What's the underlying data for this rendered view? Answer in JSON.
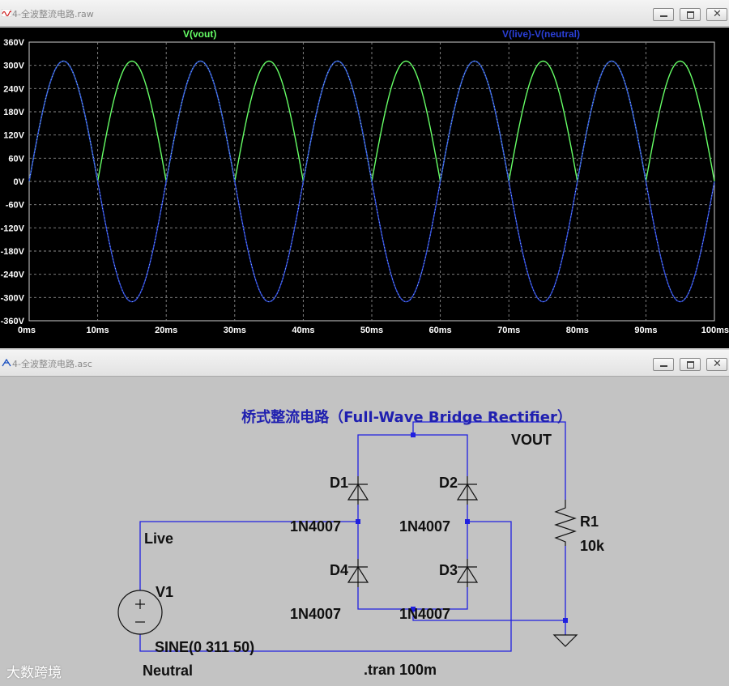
{
  "plot_window": {
    "title": "4-全波整流电路.raw",
    "icon": "waveform-icon"
  },
  "schematic_window": {
    "title": "4-全波整流电路.asc",
    "icon": "schematic-icon"
  },
  "window_buttons": [
    "minimize-icon",
    "restore-icon",
    "close-icon"
  ],
  "chart_data": {
    "type": "line",
    "title": "",
    "xlabel": "",
    "ylabel": "",
    "x_unit": "ms",
    "xlim": [
      0,
      100
    ],
    "ylim": [
      -360,
      360
    ],
    "x_ticks": [
      "0ms",
      "10ms",
      "20ms",
      "30ms",
      "40ms",
      "50ms",
      "60ms",
      "70ms",
      "80ms",
      "90ms",
      "100ms"
    ],
    "y_ticks": [
      "360V",
      "300V",
      "240V",
      "180V",
      "120V",
      "60V",
      "0V",
      "-60V",
      "-120V",
      "-180V",
      "-240V",
      "-300V",
      "-360V"
    ],
    "grid": true,
    "series": [
      {
        "name": "V(vout)",
        "color": "#66ff66",
        "x": [
          0,
          2.5,
          5,
          7.5,
          10,
          12.5,
          15,
          17.5,
          20,
          22.5,
          25,
          27.5,
          30,
          32.5,
          35,
          37.5,
          40,
          42.5,
          45,
          47.5,
          50,
          52.5,
          55,
          57.5,
          60,
          62.5,
          65,
          67.5,
          70,
          72.5,
          75,
          77.5,
          80,
          82.5,
          85,
          87.5,
          90,
          92.5,
          95,
          97.5,
          100
        ],
        "y": [
          0,
          220,
          311,
          220,
          0,
          220,
          311,
          220,
          0,
          220,
          311,
          220,
          0,
          220,
          311,
          220,
          0,
          220,
          311,
          220,
          0,
          220,
          311,
          220,
          0,
          220,
          311,
          220,
          0,
          220,
          311,
          220,
          0,
          220,
          311,
          220,
          0,
          220,
          311,
          220,
          0
        ]
      },
      {
        "name": "V(live)-V(neutral)",
        "color": "#2a3fd8",
        "x": [
          0,
          2.5,
          5,
          7.5,
          10,
          12.5,
          15,
          17.5,
          20,
          22.5,
          25,
          27.5,
          30,
          32.5,
          35,
          37.5,
          40,
          42.5,
          45,
          47.5,
          50,
          52.5,
          55,
          57.5,
          60,
          62.5,
          65,
          67.5,
          70,
          72.5,
          75,
          77.5,
          80,
          82.5,
          85,
          87.5,
          90,
          92.5,
          95,
          97.5,
          100
        ],
        "y": [
          0,
          220,
          311,
          220,
          0,
          -220,
          -311,
          -220,
          0,
          220,
          311,
          220,
          0,
          -220,
          -311,
          -220,
          0,
          220,
          311,
          220,
          0,
          -220,
          -311,
          -220,
          0,
          220,
          311,
          220,
          0,
          -220,
          -311,
          -220,
          0,
          220,
          311,
          220,
          0,
          -220,
          -311,
          -220,
          0
        ]
      }
    ],
    "trace_colors": {
      "vout": "#66ff66",
      "input": "#2a3fd8"
    }
  },
  "schematic": {
    "title": "桥式整流电路（Full-Wave Bridge Rectifier）",
    "labels": {
      "vout": "VOUT",
      "live": "Live",
      "neutral": "Neutral",
      "v1_name": "V1",
      "v1_value": "SINE(0 311 50)",
      "d1": "D1",
      "d2": "D2",
      "d3": "D3",
      "d4": "D4",
      "d1_model": "1N4007",
      "d2_model": "1N4007",
      "d3_model": "1N4007",
      "d4_model": "1N4007",
      "r1_name": "R1",
      "r1_value": "10k",
      "directive": ".tran 100m"
    },
    "wire_color": "#2020e0"
  },
  "watermark": "大数跨境"
}
